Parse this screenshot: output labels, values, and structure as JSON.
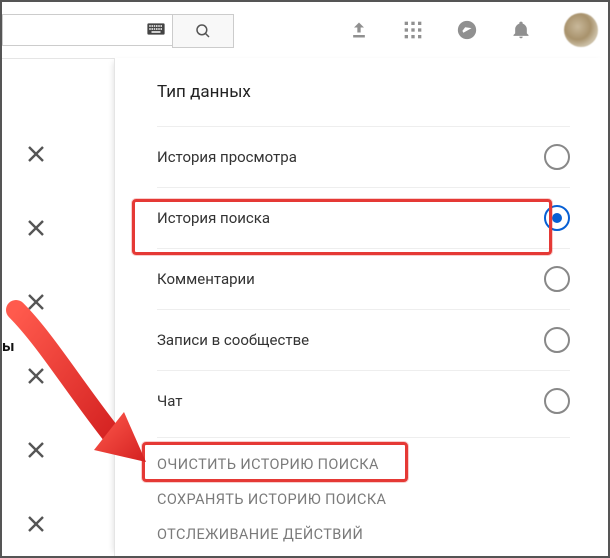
{
  "search": {
    "value": "",
    "placeholder": ""
  },
  "panel": {
    "title": "Тип данных",
    "options": [
      {
        "label": "История просмотра",
        "selected": false
      },
      {
        "label": "История поиска",
        "selected": true
      },
      {
        "label": "Комментарии",
        "selected": false
      },
      {
        "label": "Записи в сообществе",
        "selected": false
      },
      {
        "label": "Чат",
        "selected": false
      }
    ],
    "actions": [
      "ОЧИСТИТЬ ИСТОРИЮ ПОИСКА",
      "СОХРАНЯТЬ ИСТОРИЮ ПОИСКА",
      "ОТСЛЕЖИВАНИЕ ДЕЙСТВИЙ"
    ]
  },
  "left_fragment": "ы",
  "icons": {
    "keyboard": "keyboard-icon",
    "search": "search-icon",
    "upload": "upload-icon",
    "apps": "apps-grid-icon",
    "messages": "messages-icon",
    "bell": "bell-icon",
    "avatar": "avatar"
  },
  "colors": {
    "accent": "#065fd4",
    "highlight": "#e53935",
    "icon": "#909090"
  }
}
